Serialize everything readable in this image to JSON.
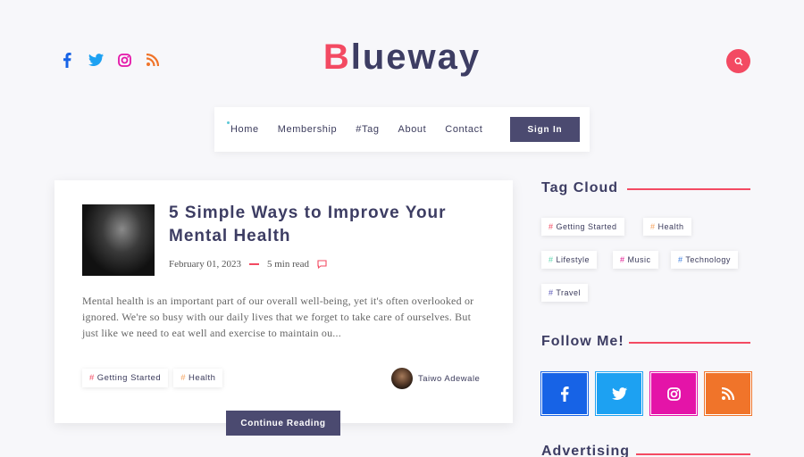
{
  "header": {
    "logo_initial": "B",
    "logo_rest": "lueway",
    "social_icons": [
      "facebook-icon",
      "twitter-icon",
      "instagram-icon",
      "rss-icon"
    ]
  },
  "nav": {
    "items": [
      "Home",
      "Membership",
      "#Tag",
      "About",
      "Contact"
    ],
    "active": "Home",
    "signin_label": "Sign In"
  },
  "post": {
    "title": "5 Simple Ways to Improve Your Mental Health",
    "date": "February 01, 2023",
    "read_time": "5 min read",
    "excerpt": "Mental health is an important part of our overall well-being, yet it's often overlooked or ignored. We're so busy with our daily lives that we forget to take care of ourselves. But just like we need to eat well and exercise to maintain ou...",
    "tags": [
      {
        "label": "Getting Started",
        "color": "#f34a62"
      },
      {
        "label": "Health",
        "color": "#f5a25d"
      }
    ],
    "author": "Taiwo Adewale",
    "continue_label": "Continue Reading"
  },
  "sidebar": {
    "tag_cloud_title": "Tag Cloud",
    "tags": [
      {
        "label": "Getting Started",
        "color": "#f34a62"
      },
      {
        "label": "Health",
        "color": "#f5a25d"
      },
      {
        "label": "Lifestyle",
        "color": "#5fd6b0"
      },
      {
        "label": "Music",
        "color": "#e0148f"
      },
      {
        "label": "Technology",
        "color": "#3b7de0"
      },
      {
        "label": "Travel",
        "color": "#5b58b8"
      }
    ],
    "follow_title": "Follow Me!",
    "follow_buttons": [
      {
        "name": "facebook",
        "color": "#1763e6"
      },
      {
        "name": "twitter",
        "color": "#1da1f2"
      },
      {
        "name": "instagram",
        "color": "#e414a8"
      },
      {
        "name": "rss",
        "color": "#f0742a"
      }
    ],
    "advertising_title": "Advertising"
  },
  "colors": {
    "accent": "#f34a62",
    "dark": "#4b4a70"
  }
}
